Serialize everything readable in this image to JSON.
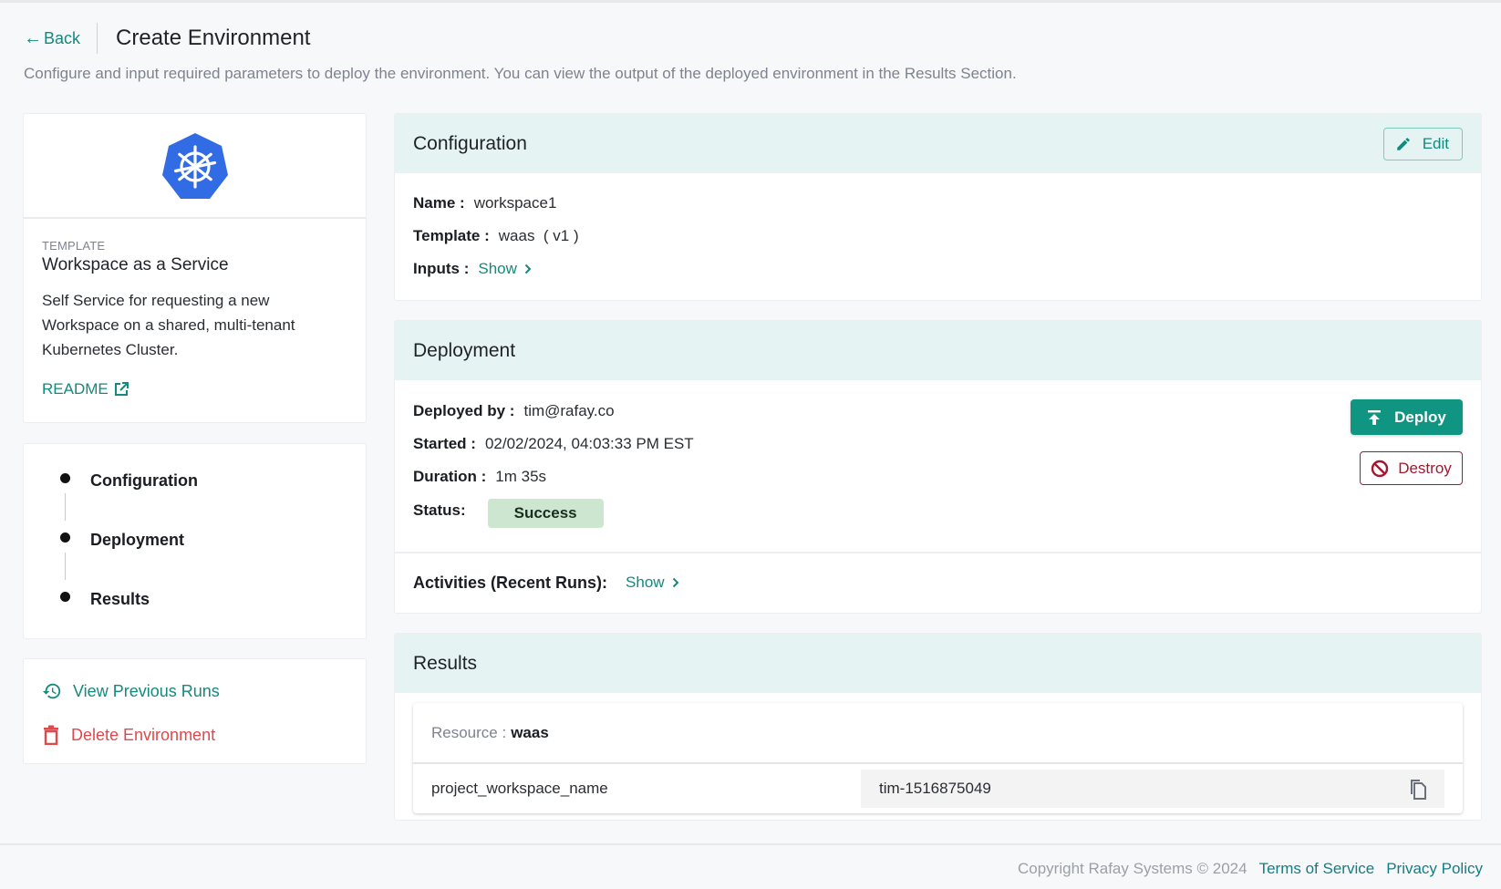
{
  "header": {
    "back_label": "Back",
    "title": "Create Environment",
    "description": "Configure and input required parameters to deploy the environment. You can view the output of the deployed environment in the Results Section."
  },
  "template_card": {
    "logo_icon": "kubernetes-helm-icon",
    "kicker": "TEMPLATE",
    "name": "Workspace as a Service",
    "description": "Self Service for requesting a new Workspace on a shared, multi-tenant Kubernetes Cluster.",
    "readme_label": "README"
  },
  "steps": [
    {
      "label": "Configuration"
    },
    {
      "label": "Deployment"
    },
    {
      "label": "Results"
    }
  ],
  "actions": {
    "view_previous_runs": "View Previous Runs",
    "delete_environment": "Delete Environment"
  },
  "configuration": {
    "title": "Configuration",
    "edit_label": "Edit",
    "name_label": "Name :",
    "name_value": "workspace1",
    "template_label": "Template :",
    "template_value": "waas  ( v1 )",
    "inputs_label": "Inputs :",
    "inputs_show": "Show"
  },
  "deployment": {
    "title": "Deployment",
    "deployed_by_label": "Deployed by :",
    "deployed_by_value": "tim@rafay.co",
    "started_label": "Started :",
    "started_value": "02/02/2024, 04:03:33 PM EST",
    "duration_label": "Duration :",
    "duration_value": "1m 35s",
    "status_label": "Status:",
    "status_value": "Success",
    "deploy_label": "Deploy",
    "destroy_label": "Destroy",
    "activities_label": "Activities (Recent Runs):",
    "activities_show": "Show",
    "colors": {
      "deploy": "#0f9582",
      "destroy": "#a3182f",
      "success_bg": "#cde6d0"
    }
  },
  "results": {
    "title": "Results",
    "resource_label": "Resource :",
    "resource_value": "waas",
    "rows": [
      {
        "key": "project_workspace_name",
        "value": "tim-1516875049"
      }
    ]
  },
  "footer": {
    "copyright": "Copyright Rafay Systems © 2024",
    "terms": "Terms of Service",
    "privacy": "Privacy Policy"
  },
  "theme": {
    "accent": "#14897e",
    "danger": "#e0484b",
    "panel_header_bg": "#e5f3f2"
  }
}
